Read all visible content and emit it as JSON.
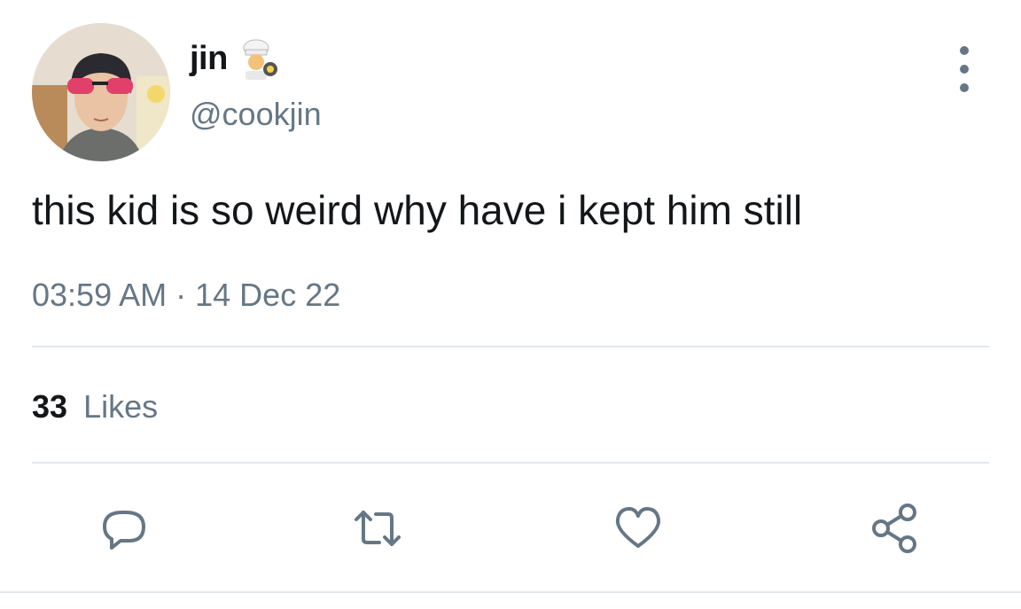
{
  "tweet": {
    "author": {
      "display_name": "jin",
      "name_emoji": "cook-emoji",
      "handle": "@cookjin"
    },
    "text": "this kid is so weird why have i kept him still",
    "time": "03:59 AM",
    "separator": "·",
    "date": "14 Dec 22",
    "likes_count": "33",
    "likes_label": "Likes"
  },
  "icons": {
    "more": "more-vertical-icon",
    "reply": "reply-icon",
    "retweet": "retweet-icon",
    "like": "heart-icon",
    "share": "share-icon"
  },
  "colors": {
    "text": "#14171a",
    "secondary": "#657786",
    "divider": "#e1e8ed",
    "background": "#ffffff"
  }
}
